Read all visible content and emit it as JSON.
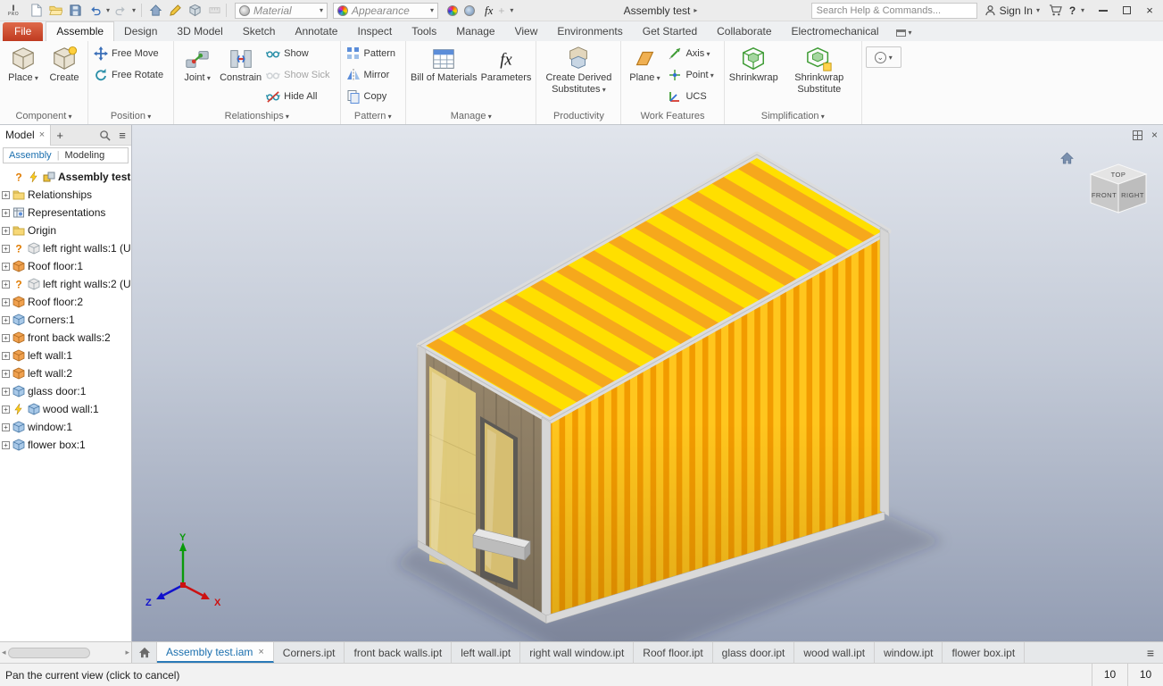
{
  "titlebar": {
    "doc_title": "Assembly test",
    "search_placeholder": "Search Help & Commands...",
    "sign_in": "Sign In",
    "material": "Material",
    "appearance": "Appearance"
  },
  "ribbon_tabs": [
    {
      "label": "File",
      "style": "file"
    },
    {
      "label": "Assemble",
      "active": true
    },
    {
      "label": "Design"
    },
    {
      "label": "3D Model"
    },
    {
      "label": "Sketch"
    },
    {
      "label": "Annotate"
    },
    {
      "label": "Inspect"
    },
    {
      "label": "Tools"
    },
    {
      "label": "Manage"
    },
    {
      "label": "View"
    },
    {
      "label": "Environments"
    },
    {
      "label": "Get Started"
    },
    {
      "label": "Collaborate"
    },
    {
      "label": "Electromechanical"
    }
  ],
  "ribbon_groups": [
    {
      "label": "Component",
      "arrow": true,
      "big": [
        {
          "label": "Place",
          "icon": "place",
          "dd": true
        },
        {
          "label": "Create",
          "icon": "create"
        }
      ],
      "small": []
    },
    {
      "label": "Position",
      "arrow": true,
      "big": [],
      "small": [
        {
          "label": "Free Move",
          "icon": "freemove"
        },
        {
          "label": "Free Rotate",
          "icon": "freerotate"
        }
      ]
    },
    {
      "label": "Relationships",
      "arrow": true,
      "big": [
        {
          "label": "Joint",
          "icon": "joint",
          "dd": true
        },
        {
          "label": "Constrain",
          "icon": "constrain"
        }
      ],
      "small": [
        {
          "label": "Show",
          "icon": "show"
        },
        {
          "label": "Show Sick",
          "icon": "showsick",
          "disabled": true
        },
        {
          "label": "Hide All",
          "icon": "hideall"
        }
      ]
    },
    {
      "label": "Pattern",
      "arrow": true,
      "big": [],
      "small": [
        {
          "label": "Pattern",
          "icon": "pattern"
        },
        {
          "label": "Mirror",
          "icon": "mirror"
        },
        {
          "label": "Copy",
          "icon": "copy"
        }
      ]
    },
    {
      "label": "Manage",
      "arrow": true,
      "big": [
        {
          "label": "Bill of Materials",
          "icon": "bom"
        },
        {
          "label": "Parameters",
          "icon": "fx"
        }
      ],
      "small": []
    },
    {
      "label": "Productivity",
      "arrow": false,
      "big": [
        {
          "label": "Create Derived Substitutes",
          "icon": "derived",
          "dd": true
        }
      ],
      "small": []
    },
    {
      "label": "Work Features",
      "arrow": false,
      "big": [
        {
          "label": "Plane",
          "icon": "plane",
          "dd": true
        }
      ],
      "small": [
        {
          "label": "Axis",
          "icon": "axis",
          "dd": true
        },
        {
          "label": "Point",
          "icon": "point",
          "dd": true
        },
        {
          "label": "UCS",
          "icon": "ucs"
        }
      ]
    },
    {
      "label": "Simplification",
      "arrow": true,
      "big": [
        {
          "label": "Shrinkwrap",
          "icon": "shrinkwrap"
        },
        {
          "label": "Shrinkwrap Substitute",
          "icon": "shrinkwrapsub"
        }
      ],
      "small": []
    }
  ],
  "browser": {
    "tab_label": "Model",
    "subtab_active": "Assembly",
    "subtab_other": "Modeling",
    "tree": [
      {
        "label": "Assembly test.ia",
        "bold": true,
        "icons": [
          "question",
          "bolt",
          "asm"
        ],
        "exp": false
      },
      {
        "label": "Relationships",
        "icons": [
          "folder"
        ],
        "exp": true
      },
      {
        "label": "Representations",
        "icons": [
          "reps"
        ],
        "exp": true
      },
      {
        "label": "Origin",
        "icons": [
          "folder"
        ],
        "exp": true
      },
      {
        "label": "left right walls:1 (U",
        "icons": [
          "question",
          "ghost"
        ],
        "exp": true
      },
      {
        "label": "Roof floor:1",
        "icons": [
          "orange"
        ],
        "exp": true
      },
      {
        "label": "left right walls:2 (U",
        "icons": [
          "question",
          "ghost"
        ],
        "exp": true
      },
      {
        "label": "Roof floor:2",
        "icons": [
          "orange"
        ],
        "exp": true
      },
      {
        "label": "Corners:1",
        "icons": [
          "blue"
        ],
        "exp": true
      },
      {
        "label": "front back walls:2",
        "icons": [
          "orange"
        ],
        "exp": true
      },
      {
        "label": "left wall:1",
        "icons": [
          "orange"
        ],
        "exp": true
      },
      {
        "label": "left wall:2",
        "icons": [
          "orange"
        ],
        "exp": true
      },
      {
        "label": "glass door:1",
        "icons": [
          "blue"
        ],
        "exp": true
      },
      {
        "label": "wood wall:1",
        "icons": [
          "bolt",
          "blue"
        ],
        "exp": true
      },
      {
        "label": "window:1",
        "icons": [
          "blue"
        ],
        "exp": true
      },
      {
        "label": "flower box:1",
        "icons": [
          "blue"
        ],
        "exp": true
      }
    ]
  },
  "viewport": {
    "viewcube": {
      "top": "TOP",
      "front": "FRONT",
      "right": "RIGHT"
    },
    "triad": {
      "x": "X",
      "y": "Y",
      "z": "Z"
    }
  },
  "doc_tabs": [
    {
      "label": "Assembly test.iam",
      "active": true
    },
    {
      "label": "Corners.ipt"
    },
    {
      "label": "front back walls.ipt"
    },
    {
      "label": "left wall.ipt"
    },
    {
      "label": "right wall window.ipt"
    },
    {
      "label": "Roof floor.ipt"
    },
    {
      "label": "glass door.ipt"
    },
    {
      "label": "wood wall.ipt"
    },
    {
      "label": "window.ipt"
    },
    {
      "label": "flower box.ipt"
    }
  ],
  "statusbar": {
    "message": "Pan the current view (click to cancel)",
    "count_a": "10",
    "count_b": "10"
  },
  "scene": {
    "colors": {
      "accent_blue": "#1b6fae",
      "wall_light": "#ffc61e",
      "wall_stripe": "#f29b00",
      "roof": "#ffdf00",
      "roof_stripe": "#f6a81c",
      "wood_top": "#98876c",
      "wood_bottom": "#7b6e58",
      "frame": "#d6d6d6",
      "glass": "#e6d07d",
      "door_frame": "#5d5a55"
    }
  }
}
